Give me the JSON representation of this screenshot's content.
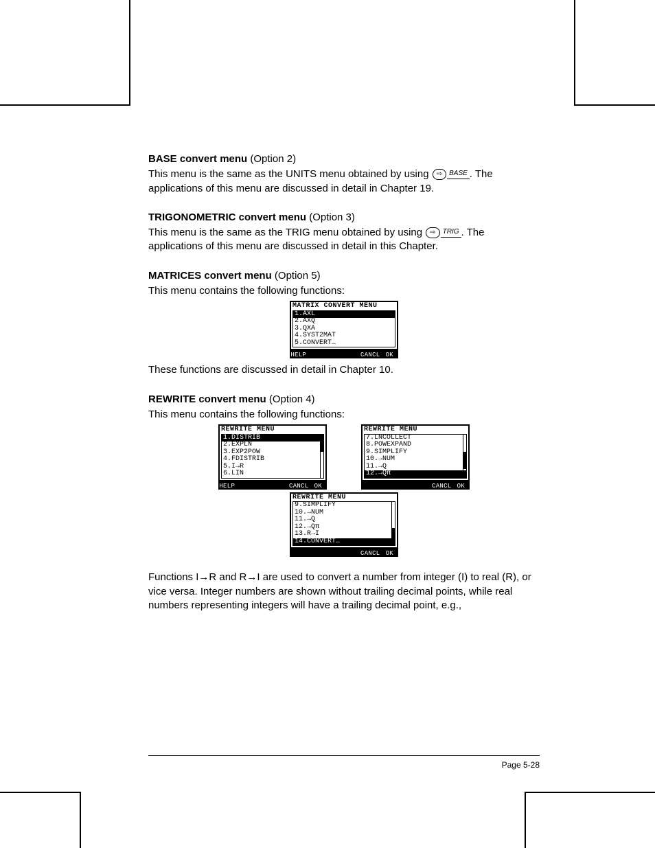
{
  "sections": {
    "base": {
      "heading": "BASE convert menu",
      "option": " (Option 2)",
      "p1a": "This menu is the same as the UNITS menu obtained by using ",
      "keylabel": "BASE",
      "p1b": ".  The applications of this menu are discussed in detail in Chapter 19."
    },
    "trig": {
      "heading": "TRIGONOMETRIC convert menu",
      "option": " (Option 3)",
      "p1a": "This menu is the same as the TRIG  menu obtained by using ",
      "keylabel": "TRIG",
      "p1b": ".  The applications of this menu are discussed in detail in this Chapter."
    },
    "matrices": {
      "heading": "MATRICES convert menu",
      "option": " (Option 5)",
      "p1": "This menu contains the following functions:",
      "after": "These functions are discussed in detail in Chapter 10.",
      "calc": {
        "title": "MATRIX CONVERT MENU",
        "items": [
          "1.AXL",
          "2.AXQ",
          "3.QXA",
          "4.SYST2MAT",
          "5.CONVERT…"
        ],
        "selected": 0,
        "softkeys": [
          "HELP",
          "",
          "",
          "",
          "CANCL",
          "OK"
        ]
      }
    },
    "rewrite": {
      "heading": "REWRITE convert menu",
      "option": " (Option 4)",
      "p1": "This menu contains the following functions:",
      "calc1": {
        "title": "REWRITE MENU",
        "items": [
          "1.DISTRIB",
          "2.EXPLN",
          "3.EXP2POW",
          "4.FDISTRIB",
          "5.I→R",
          "6.LIN"
        ],
        "selected": 0,
        "softkeys": [
          "HELP",
          "",
          "",
          "",
          "CANCL",
          "OK"
        ]
      },
      "calc2": {
        "title": "REWRITE MENU",
        "items": [
          "7.LNCOLLECT",
          "8.POWEXPAND",
          "9.SIMPLIFY",
          "10.→NUM",
          "11.→Q",
          "12.→Qπ"
        ],
        "selected": 5,
        "softkeys": [
          "",
          "",
          "",
          "",
          "CANCL",
          "OK"
        ]
      },
      "calc3": {
        "title": "REWRITE MENU",
        "items": [
          "9.SIMPLIFY",
          "10.→NUM",
          "11.→Q",
          "12.→Qπ",
          "13.R→I",
          "14.CONVERT…"
        ],
        "selected": 5,
        "softkeys": [
          "",
          "",
          "",
          "",
          "CANCL",
          "OK"
        ]
      },
      "after": "Functions I→R and R→I are used to convert a number from integer (I) to real (R), or vice versa.  Integer numbers are shown without trailing decimal points, while real numbers representing integers will have a trailing decimal point, e.g.,"
    }
  },
  "shiftglyph": "⇨",
  "footer": {
    "page": "Page 5-28"
  }
}
